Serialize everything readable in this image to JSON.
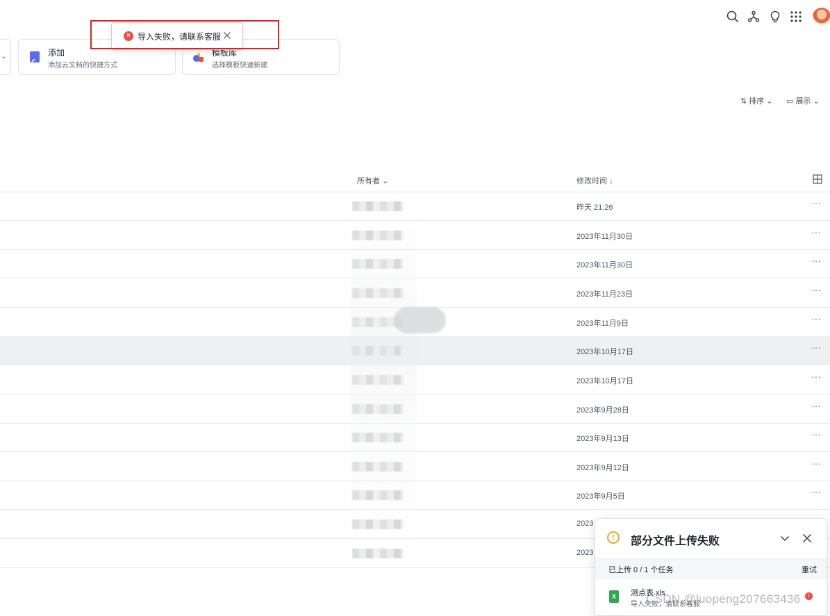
{
  "toast": {
    "message": "导入失败，请联系客服"
  },
  "cards": [
    {
      "title": "添加",
      "desc": "添加云文档的快捷方式"
    },
    {
      "title": "模板库",
      "desc": "选择模板快速新建"
    }
  ],
  "toolbar": {
    "sort_label": "排序",
    "view_label": "展示"
  },
  "table": {
    "col_owner": "所有者",
    "col_modified": "修改时间",
    "rows": [
      {
        "modified": "昨天 21:26"
      },
      {
        "modified": "2023年11月30日"
      },
      {
        "modified": "2023年11月30日"
      },
      {
        "modified": "2023年11月23日"
      },
      {
        "modified": "2023年11月9日"
      },
      {
        "modified": "2023年10月17日"
      },
      {
        "modified": "2023年10月17日"
      },
      {
        "modified": "2023年9月28日"
      },
      {
        "modified": "2023年9月13日"
      },
      {
        "modified": "2023年9月12日"
      },
      {
        "modified": "2023年9月5日"
      },
      {
        "modified": "2023"
      },
      {
        "modified": "2023"
      }
    ]
  },
  "upload_panel": {
    "title": "部分文件上传失败",
    "status": "已上传 0 / 1 个任务",
    "retry_label": "重试",
    "file_name": "测点表.xls",
    "file_status": "导入失败，请联系客服",
    "file_type": "X"
  },
  "watermark": "CSDN @luopeng207663436",
  "colors": {
    "error": "#f54a45",
    "warning": "#f5a623",
    "excel_green": "#2fa84f",
    "highlight": "#e02020"
  }
}
